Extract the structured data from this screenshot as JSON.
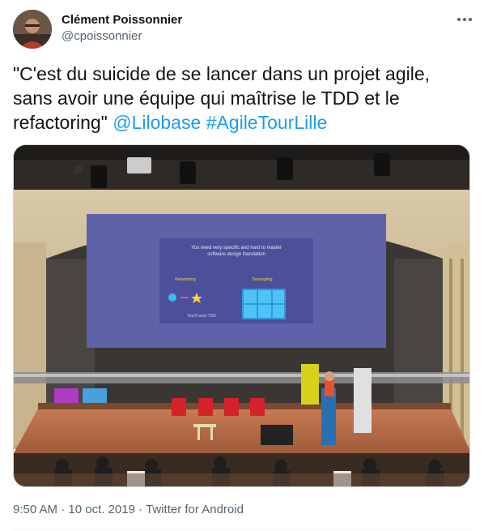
{
  "author": {
    "name": "Clément Poissonnier",
    "handle": "@cpoissonnier"
  },
  "tweet": {
    "text_before_mentions": "\"C'est du suicide de se lancer dans un projet agile, sans avoir une équipe qui maîtrise le TDD et le refactoring\" ",
    "mention": "@Lilobase",
    "hashtag": "#AgileTourLille"
  },
  "media": {
    "slide_title_line1": "You need very specific and hard to master",
    "slide_title_line2": "software design foundation",
    "slide_label_left": "Refactoring",
    "slide_label_right": "Decoupling",
    "slide_caption": "You'll need TDD"
  },
  "meta": {
    "time": "9:50 AM",
    "separator": " · ",
    "date": "10 oct. 2019",
    "source": "Twitter for Android"
  },
  "icons": {
    "more": "more-dots-icon",
    "avatar": "avatar"
  }
}
